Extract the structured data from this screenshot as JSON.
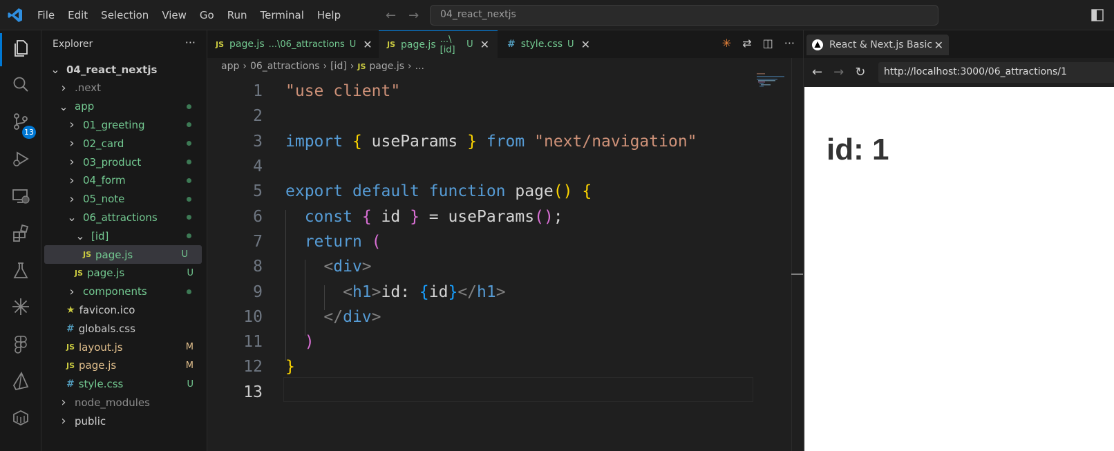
{
  "titlebar": {
    "menu": [
      "File",
      "Edit",
      "Selection",
      "View",
      "Go",
      "Run",
      "Terminal",
      "Help"
    ],
    "search_text": "04_react_nextjs"
  },
  "activity_bar": {
    "icons": [
      "files-icon",
      "search-icon",
      "source-control-icon",
      "run-debug-icon",
      "remote-explorer-icon",
      "extensions-icon",
      "testing-icon",
      "sparkle-icon",
      "figma-icon",
      "prisma-icon",
      "docker-icon"
    ],
    "source_control_badge": "13"
  },
  "sidebar": {
    "title": "Explorer",
    "more": "···",
    "tree": [
      {
        "name": "04_react_nextjs",
        "kind": "folder-open",
        "indent": 0,
        "color": "white",
        "bold": true
      },
      {
        "name": ".next",
        "kind": "folder",
        "indent": 1,
        "color": "gray"
      },
      {
        "name": "app",
        "kind": "folder-open",
        "indent": 1,
        "color": "green",
        "dot": true
      },
      {
        "name": "01_greeting",
        "kind": "folder",
        "indent": 2,
        "color": "green",
        "dot": true
      },
      {
        "name": "02_card",
        "kind": "folder",
        "indent": 2,
        "color": "green",
        "dot": true
      },
      {
        "name": "03_product",
        "kind": "folder",
        "indent": 2,
        "color": "green",
        "dot": true
      },
      {
        "name": "04_form",
        "kind": "folder",
        "indent": 2,
        "color": "green",
        "dot": true
      },
      {
        "name": "05_note",
        "kind": "folder",
        "indent": 2,
        "color": "green",
        "dot": true
      },
      {
        "name": "06_attractions",
        "kind": "folder-open",
        "indent": 2,
        "color": "green",
        "dot": true
      },
      {
        "name": "[id]",
        "kind": "folder-open",
        "indent": 3,
        "color": "green",
        "dot": true
      },
      {
        "name": "page.js",
        "kind": "js",
        "indent": 4,
        "color": "green",
        "status": "U",
        "selected": true
      },
      {
        "name": "page.js",
        "kind": "js",
        "indent": 3,
        "color": "green",
        "status": "U"
      },
      {
        "name": "components",
        "kind": "folder",
        "indent": 2,
        "color": "green",
        "dot": true
      },
      {
        "name": "favicon.ico",
        "kind": "star",
        "indent": 2,
        "color": "white"
      },
      {
        "name": "globals.css",
        "kind": "css",
        "indent": 2,
        "color": "white"
      },
      {
        "name": "layout.js",
        "kind": "js",
        "indent": 2,
        "color": "gold",
        "status": "M"
      },
      {
        "name": "page.js",
        "kind": "js",
        "indent": 2,
        "color": "gold",
        "status": "M"
      },
      {
        "name": "style.css",
        "kind": "css",
        "indent": 2,
        "color": "green",
        "status": "U"
      },
      {
        "name": "node_modules",
        "kind": "folder",
        "indent": 1,
        "color": "gray"
      },
      {
        "name": "public",
        "kind": "folder",
        "indent": 1,
        "color": "white"
      }
    ]
  },
  "editor": {
    "tabs": [
      {
        "icon": "JS",
        "name": "page.js",
        "path": "...\\06_attractions",
        "status": "U",
        "active": false
      },
      {
        "icon": "JS",
        "name": "page.js",
        "path": "...\\[id]",
        "status": "U",
        "active": true
      },
      {
        "icon": "#",
        "name": "style.css",
        "path": "",
        "status": "U",
        "active": false
      }
    ],
    "breadcrumb": [
      "app",
      "06_attractions",
      "[id]",
      "page.js",
      "..."
    ],
    "code_lines": [
      [
        [
          "s-str",
          "\"use client\""
        ]
      ],
      [],
      [
        [
          "s-kw",
          "import"
        ],
        [
          "s-txt",
          " "
        ],
        [
          "s-b1",
          "{"
        ],
        [
          "s-txt",
          " useParams "
        ],
        [
          "s-b1",
          "}"
        ],
        [
          "s-txt",
          " "
        ],
        [
          "s-kw",
          "from"
        ],
        [
          "s-txt",
          " "
        ],
        [
          "s-str",
          "\"next/navigation\""
        ]
      ],
      [],
      [
        [
          "s-kw",
          "export"
        ],
        [
          "s-txt",
          " "
        ],
        [
          "s-kw",
          "default"
        ],
        [
          "s-txt",
          " "
        ],
        [
          "s-kw",
          "function"
        ],
        [
          "s-txt",
          " page"
        ],
        [
          "s-b1",
          "()"
        ],
        [
          "s-txt",
          " "
        ],
        [
          "s-b1",
          "{"
        ]
      ],
      [
        [
          "s-txt",
          "  "
        ],
        [
          "s-kw",
          "const"
        ],
        [
          "s-txt",
          " "
        ],
        [
          "s-b2",
          "{"
        ],
        [
          "s-txt",
          " id "
        ],
        [
          "s-b2",
          "}"
        ],
        [
          "s-txt",
          " = useParams"
        ],
        [
          "s-b2",
          "()"
        ],
        [
          "s-txt",
          ";"
        ]
      ],
      [
        [
          "s-txt",
          "  "
        ],
        [
          "s-kw",
          "return"
        ],
        [
          "s-txt",
          " "
        ],
        [
          "s-b2",
          "("
        ]
      ],
      [
        [
          "s-txt",
          "    "
        ],
        [
          "s-pun",
          "<"
        ],
        [
          "s-tag",
          "div"
        ],
        [
          "s-pun",
          ">"
        ]
      ],
      [
        [
          "s-txt",
          "      "
        ],
        [
          "s-pun",
          "<"
        ],
        [
          "s-tag",
          "h1"
        ],
        [
          "s-pun",
          ">"
        ],
        [
          "s-txt",
          "id: "
        ],
        [
          "s-b3",
          "{"
        ],
        [
          "s-txt",
          "id"
        ],
        [
          "s-b3",
          "}"
        ],
        [
          "s-pun",
          "</"
        ],
        [
          "s-tag",
          "h1"
        ],
        [
          "s-pun",
          ">"
        ]
      ],
      [
        [
          "s-txt",
          "    "
        ],
        [
          "s-pun",
          "</"
        ],
        [
          "s-tag",
          "div"
        ],
        [
          "s-pun",
          ">"
        ]
      ],
      [
        [
          "s-txt",
          "  "
        ],
        [
          "s-b2",
          ")"
        ]
      ],
      [
        [
          "s-b1",
          "}"
        ]
      ],
      []
    ]
  },
  "browser": {
    "tab_title": "React & Next.js Basic",
    "url": "http://localhost:3000/06_attractions/1",
    "heading": "id: 1"
  },
  "colors": {
    "accent": "#0078d4",
    "untracked_green": "#73c991",
    "modified_gold": "#e2c08d"
  }
}
